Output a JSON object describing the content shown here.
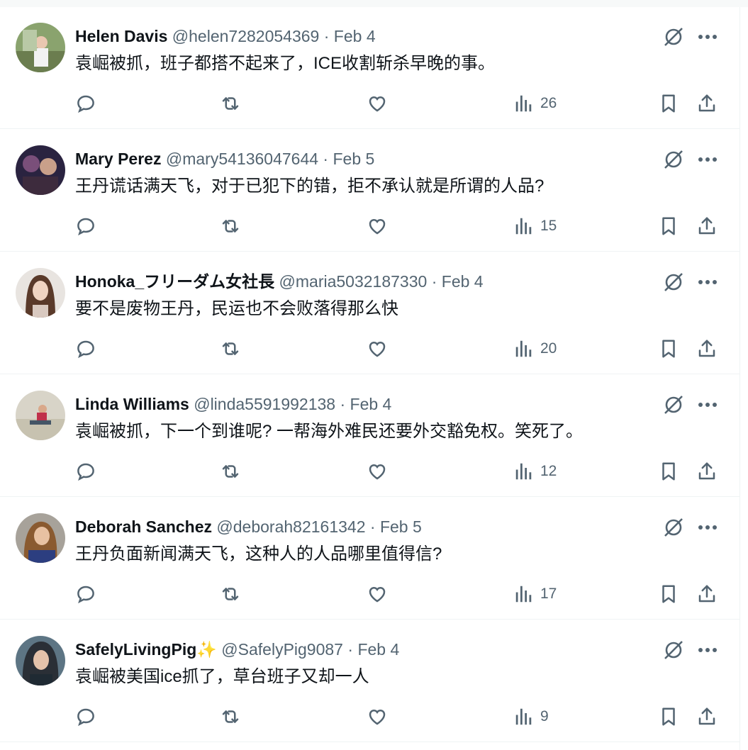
{
  "colors": {
    "text": "#0f1419",
    "secondary": "#536471",
    "border": "#eff3f4"
  },
  "posts": [
    {
      "name": "Helen Davis",
      "handle": "@helen7282054369",
      "date": "Feb 4",
      "text": "袁崛被抓，班子都搭不起来了，ICE收割斩杀早晚的事。",
      "views": "26"
    },
    {
      "name": "Mary Perez",
      "handle": "@mary54136047644",
      "date": "Feb 5",
      "text": "王丹谎话满天飞，对于已犯下的错，拒不承认就是所谓的人品?",
      "views": "15"
    },
    {
      "name": "Honoka_フリーダム女社長",
      "handle": "@maria5032187330",
      "date": "Feb 4",
      "text": "要不是废物王丹，民运也不会败落得那么快",
      "views": "20"
    },
    {
      "name": "Linda Williams",
      "handle": "@linda5591992138",
      "date": "Feb 4",
      "text": "袁崛被抓，下一个到谁呢? 一帮海外难民还要外交豁免权。笑死了。",
      "views": "12"
    },
    {
      "name": "Deborah Sanchez",
      "handle": "@deborah82161342",
      "date": "Feb 5",
      "text": "王丹负面新闻满天飞，这种人的人品哪里值得信?",
      "views": "17"
    },
    {
      "name": "SafelyLivingPig✨",
      "handle": "@SafelyPig9087",
      "date": "Feb 4",
      "text": "袁崛被美国ice抓了，草台班子又却一人",
      "views": "9"
    }
  ],
  "separator": "·"
}
